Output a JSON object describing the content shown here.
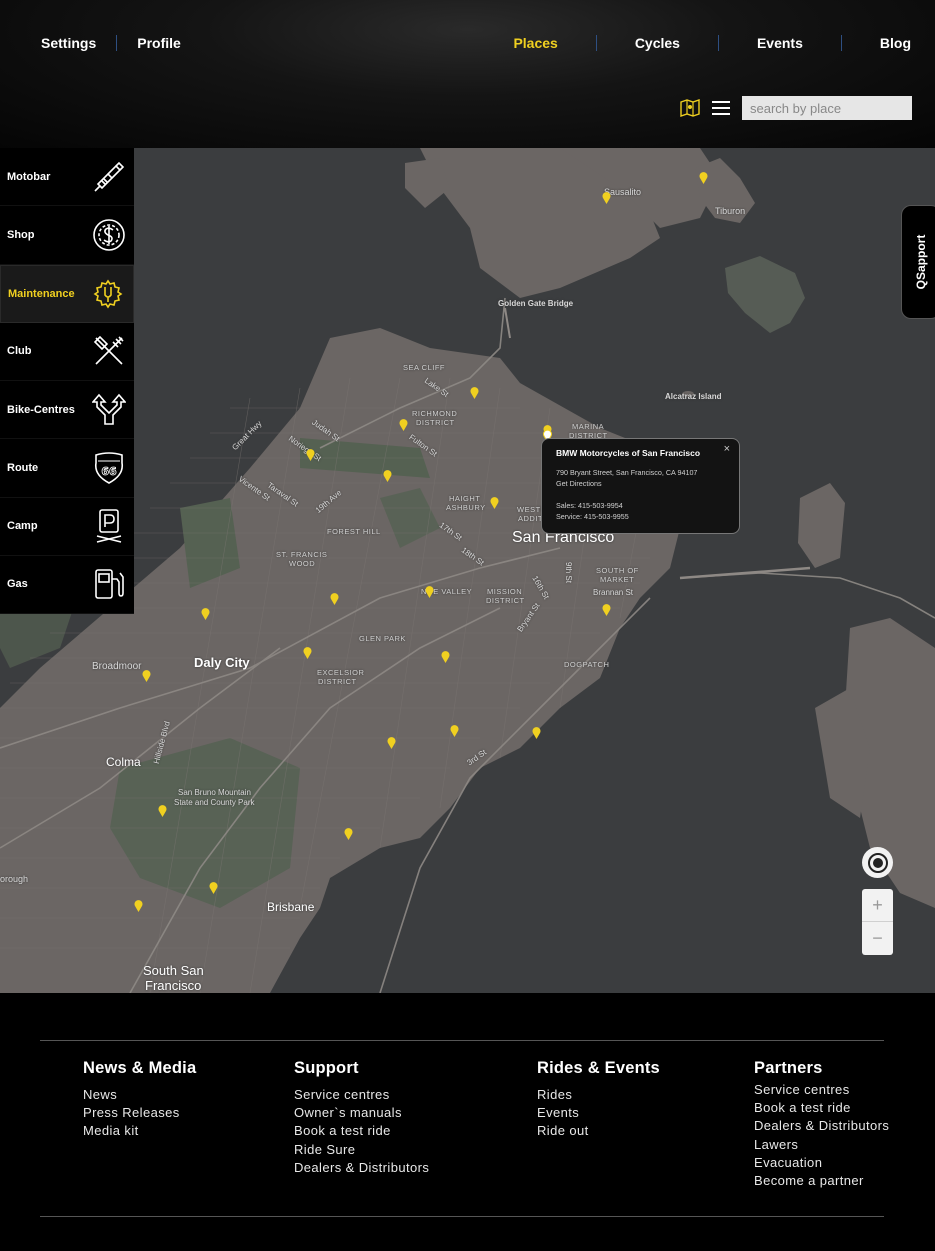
{
  "header": {
    "nav_left": [
      "Settings",
      "Profile"
    ],
    "nav_right": [
      "Places",
      "Cycles",
      "Events",
      "Blog"
    ],
    "active_nav": "Places",
    "search_placeholder": "search by place"
  },
  "sidebar": {
    "items": [
      {
        "label": "Motobar",
        "icon": "spark-plug-icon"
      },
      {
        "label": "Shop",
        "icon": "dollar-coin-icon"
      },
      {
        "label": "Maintenance",
        "icon": "gear-wrench-icon",
        "active": true
      },
      {
        "label": "Club",
        "icon": "fork-knife-icon"
      },
      {
        "label": "Bike-Centres",
        "icon": "split-arrows-icon"
      },
      {
        "label": "Route",
        "icon": "route-66-icon"
      },
      {
        "label": "Camp",
        "icon": "parking-icon"
      },
      {
        "label": "Gas",
        "icon": "fuel-pump-icon"
      }
    ]
  },
  "map": {
    "labels": {
      "sausalito": "Sausalito",
      "tiburon": "Tiburon",
      "golden_gate": "Golden Gate Bridge",
      "alcatraz": "Alcatraz Island",
      "sea_cliff": "SEA CLIFF",
      "richmond": "RICHMOND",
      "district": "DISTRICT",
      "marina": "MARINA",
      "haight": "HAIGHT",
      "ashbury": "ASHBURY",
      "western": "WESTERN",
      "addition": "ADDITION",
      "forest_hill": "FOREST HILL",
      "st_francis": "ST. FRANCIS",
      "wood": "WOOD",
      "noe_valley": "NOE VALLEY",
      "mission": "MISSION",
      "south_of": "SOUTH OF",
      "market": "MARKET",
      "glen_park": "GLEN PARK",
      "excelsior": "EXCELSIOR",
      "dogpatch": "DOGPATCH",
      "san_francisco": "San Francisco",
      "daly_city": "Daly City",
      "broadmoor": "Broadmoor",
      "colma": "Colma",
      "san_bruno_1": "San Bruno Mountain",
      "san_bruno_2": "State and County Park",
      "brisbane": "Brisbane",
      "south_sf_1": "South San",
      "south_sf_2": "Francisco",
      "orough": "orough",
      "great_hwy": "Great Hwy",
      "judah": "Judah St",
      "noriega": "Noriega St",
      "vicente": "Vicente St",
      "taraval": "Taraval St",
      "nineteenth": "19th Ave",
      "lake": "Lake St",
      "fulton": "Fulton St",
      "seventeenth": "17th St",
      "eighteenth": "18th St",
      "sixteenth": "16th St",
      "ninth": "9th St",
      "brannan": "Brannan St",
      "bryant": "Bryant St",
      "third": "3rd St",
      "hillside": "Hillside Blvd"
    },
    "popup": {
      "title": "BMW Motorcycles of San Francisco",
      "address": "790 Bryant Street, San Francisco, CA 94107",
      "directions": "Get Directions",
      "sales": "Sales: 415-503-9954",
      "service": "Service: 415-503-9955",
      "close": "×"
    },
    "qsupport": "QSapport",
    "zoom_in": "+",
    "zoom_out": "−",
    "pin_color": "#f0d020"
  },
  "footer": {
    "columns": [
      {
        "heading": "News & Media",
        "links": [
          "News",
          "Press Releases",
          "Media kit"
        ]
      },
      {
        "heading": "Support",
        "links": [
          "Service centres",
          "Owner`s manuals",
          "Book a test ride",
          "Ride Sure",
          "Dealers  & Distributors"
        ]
      },
      {
        "heading": "Rides & Events",
        "links": [
          "Rides",
          "Events",
          "Ride out"
        ]
      },
      {
        "heading": "Partners",
        "links": [
          "Service centres",
          "Book a test ride",
          "Dealers  & Distributors",
          "Lawers",
          "Evacuation",
          "Become a partner"
        ]
      }
    ]
  },
  "colors": {
    "accent": "#f0d020",
    "nav_separator": "#2e4f82",
    "water": "#3b3d3f",
    "land": "#6b6664",
    "park": "#556152"
  }
}
